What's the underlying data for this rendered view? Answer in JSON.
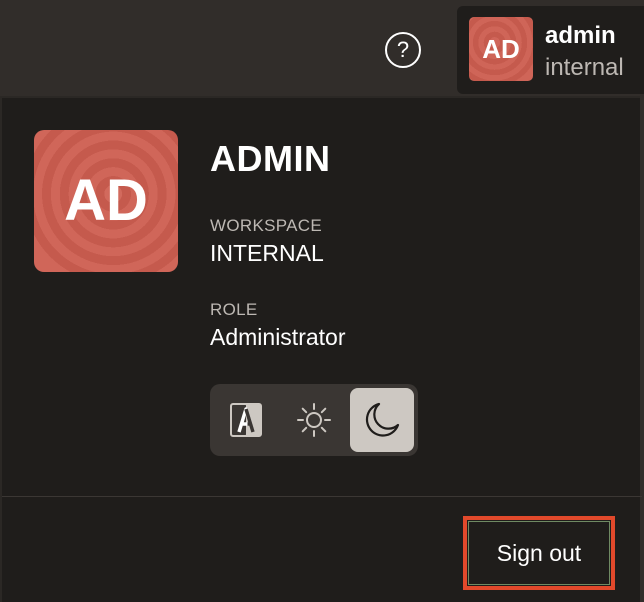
{
  "header": {
    "help_symbol": "?",
    "user_menu": {
      "initials": "AD",
      "name": "admin",
      "workspace": "internal"
    }
  },
  "panel": {
    "initials": "AD",
    "user_name": "ADMIN",
    "workspace_label": "WORKSPACE",
    "workspace_value": "INTERNAL",
    "role_label": "ROLE",
    "role_value": "Administrator",
    "theme_options": [
      "auto",
      "light",
      "dark"
    ],
    "selected_theme": "dark",
    "sign_out_label": "Sign out"
  },
  "colors": {
    "avatar": "#c75c4f",
    "highlight": "#e2492b",
    "selected_theme_bg": "#cdc8c2"
  }
}
